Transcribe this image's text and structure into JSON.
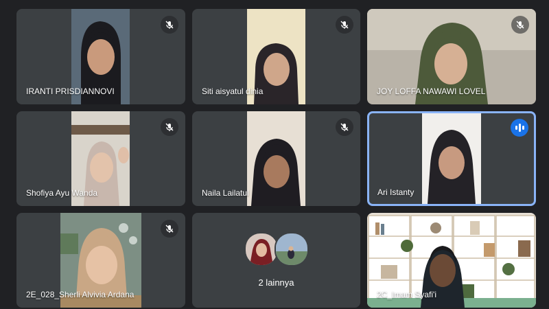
{
  "meeting": {
    "participants": [
      {
        "name": "IRANTI PRISDIANNOVI",
        "muted": true
      },
      {
        "name": "Siti aisyatul dinia",
        "muted": true
      },
      {
        "name": "JOY LOFFA NAWAWI LOVEL",
        "muted": true
      },
      {
        "name": "Shofiya Ayu Wanda",
        "muted": true
      },
      {
        "name": "Naila Lailatul",
        "muted": true
      },
      {
        "name": "Ari Istanty",
        "muted": false,
        "speaking": true
      },
      {
        "name": "2E_028_Sherli Alvivia Ardana",
        "muted": true
      },
      {
        "name": "2C_Imam Syafi'i",
        "muted": false
      }
    ],
    "others": {
      "label": "2 lainnya"
    }
  },
  "colors": {
    "background": "#202124",
    "tile": "#3c4043",
    "active_border": "#8ab4f8",
    "speaking_badge": "#1a73e8"
  },
  "icons": {
    "muted": "mic-off-icon",
    "speaking": "audio-level-icon"
  }
}
